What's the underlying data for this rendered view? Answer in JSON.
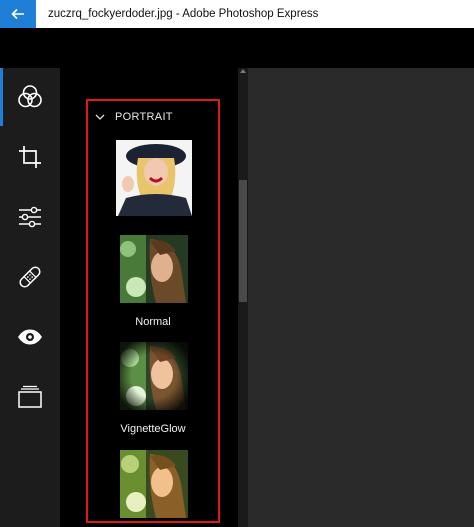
{
  "window": {
    "title": "zuczrq_fockyerdoder.jpg - Adobe Photoshop Express"
  },
  "toolbar": {
    "tools": [
      {
        "name": "looks",
        "icon": "looks-icon"
      },
      {
        "name": "crop",
        "icon": "crop-icon"
      },
      {
        "name": "adjust",
        "icon": "sliders-icon"
      },
      {
        "name": "heal",
        "icon": "bandage-icon"
      },
      {
        "name": "red-eye",
        "icon": "eye-icon"
      },
      {
        "name": "borders",
        "icon": "borders-icon"
      }
    ],
    "active_index": 0,
    "accent_color": "#1f7fd6"
  },
  "looks_panel": {
    "section_title": "PORTRAIT",
    "highlight_color": "#e01818",
    "items": [
      {
        "label": "Normal"
      },
      {
        "label": "VignetteGlow"
      }
    ]
  }
}
